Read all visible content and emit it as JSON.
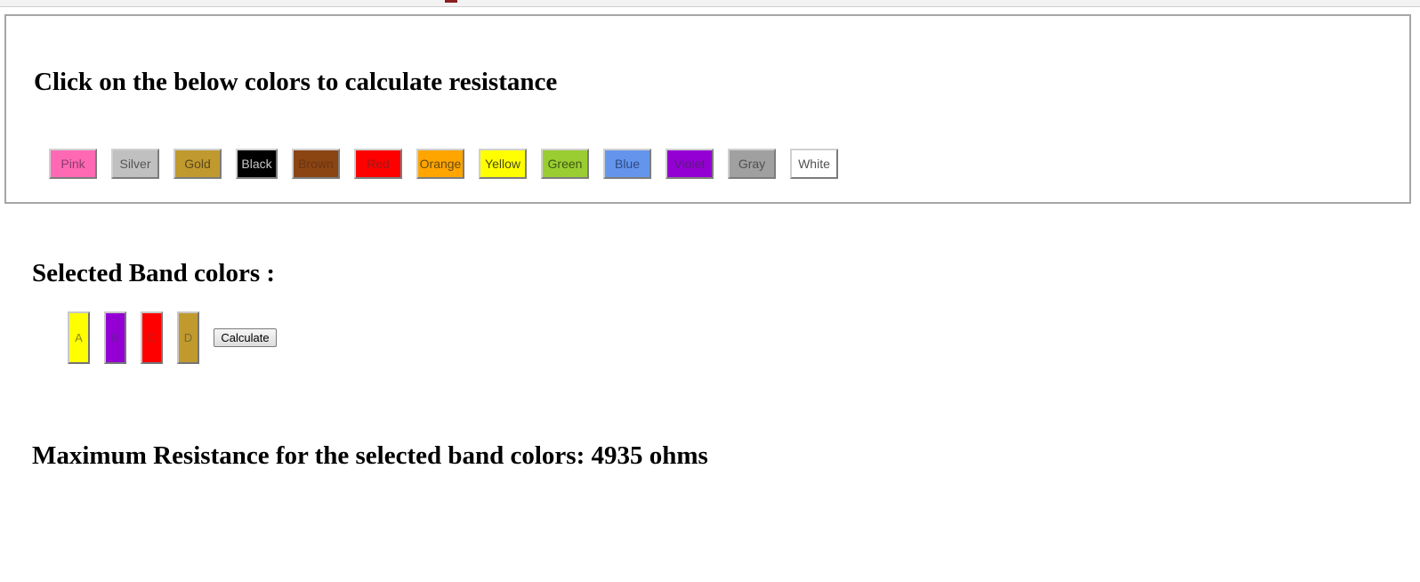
{
  "panel": {
    "title": "Click on the below colors to calculate resistance",
    "colors": [
      {
        "label": "Pink",
        "bg": "#ff69b4",
        "fg": "#8a3a6a"
      },
      {
        "label": "Silver",
        "bg": "#c0c0c0",
        "fg": "#555555"
      },
      {
        "label": "Gold",
        "bg": "#c09a2f",
        "fg": "#5a4a1a"
      },
      {
        "label": "Black",
        "bg": "#000000",
        "fg": "#c8c8c8"
      },
      {
        "label": "Brown",
        "bg": "#8b4513",
        "fg": "#6a3410"
      },
      {
        "label": "Red",
        "bg": "#ff0000",
        "fg": "#a01818"
      },
      {
        "label": "Orange",
        "bg": "#ffa500",
        "fg": "#6a4a10"
      },
      {
        "label": "Yellow",
        "bg": "#ffff00",
        "fg": "#4a4a1a"
      },
      {
        "label": "Green",
        "bg": "#9acd32",
        "fg": "#3d5a14"
      },
      {
        "label": "Blue",
        "bg": "#6495ed",
        "fg": "#2f4a80"
      },
      {
        "label": "Violet",
        "bg": "#9400d3",
        "fg": "#5a1a80"
      },
      {
        "label": "Gray",
        "bg": "#a0a0a0",
        "fg": "#505050"
      },
      {
        "label": "White",
        "bg": "#ffffff",
        "fg": "#505050"
      }
    ]
  },
  "bands": {
    "heading": "Selected Band colors :",
    "items": [
      {
        "label": "A",
        "bg": "#ffff00",
        "fg": "#8a8a1a"
      },
      {
        "label": "B",
        "bg": "#9400d3",
        "fg": "#6a1aa0"
      },
      {
        "label": "C",
        "bg": "#ff0000",
        "fg": "#c01818"
      },
      {
        "label": "D",
        "bg": "#c09a2f",
        "fg": "#7a6a2a"
      }
    ],
    "calculate_label": "Calculate"
  },
  "result": {
    "text": "Maximum Resistance for the selected band colors: 4935 ohms"
  }
}
